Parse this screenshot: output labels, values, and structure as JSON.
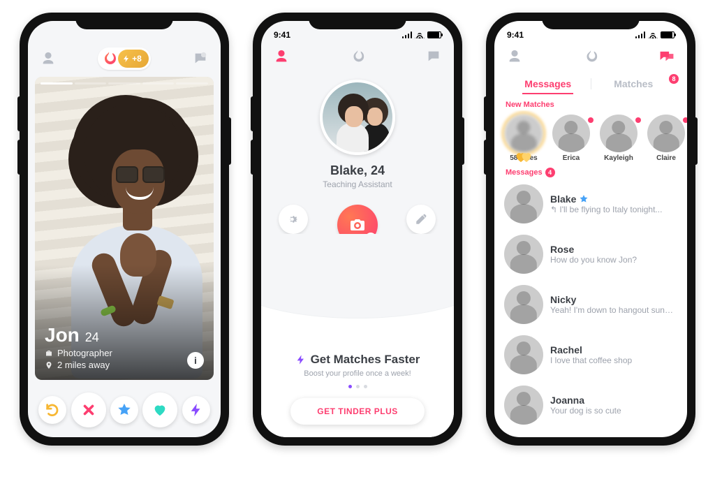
{
  "status": {
    "time": "9:41"
  },
  "nav": {
    "boost_count": "+8"
  },
  "swipe": {
    "name": "Jon",
    "age": "24",
    "job": "Photographer",
    "distance": "2 miles away"
  },
  "actions": {
    "rewind": "rewind",
    "nope": "nope",
    "superlike": "super-like",
    "like": "like",
    "boost": "boost"
  },
  "profile": {
    "name_age": "Blake, 24",
    "subtitle": "Teaching Assistant",
    "settings_label": "SETTINGS",
    "add_photos_label": "ADD PHOTOS",
    "edit_info_label": "EDIT INFO",
    "promo_title": "Get Matches Faster",
    "promo_sub": "Boost your profile once a week!",
    "cta": "GET TINDER PLUS"
  },
  "messages": {
    "tab_messages": "Messages",
    "tab_matches": "Matches",
    "matches_badge": "8",
    "new_matches_header": "New Matches",
    "messages_header": "Messages",
    "messages_badge": "4",
    "likes_label": "58 Likes",
    "match_list": [
      {
        "name": "Erica"
      },
      {
        "name": "Kayleigh"
      },
      {
        "name": "Claire"
      }
    ],
    "threads": [
      {
        "name": "Blake",
        "preview": "↰ I'll be flying to Italy tonight...",
        "star": true
      },
      {
        "name": "Rose",
        "preview": "How do you know Jon?"
      },
      {
        "name": "Nicky",
        "preview": "Yeah! I'm down to hangout sunday..."
      },
      {
        "name": "Rachel",
        "preview": "I love that coffee shop"
      },
      {
        "name": "Joanna",
        "preview": "Your dog is so cute"
      }
    ]
  }
}
